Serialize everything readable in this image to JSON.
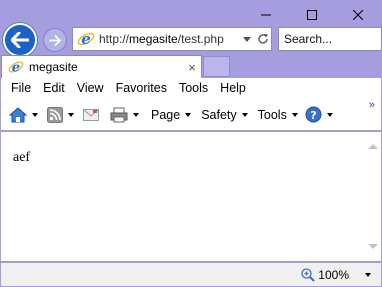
{
  "window": {
    "caption_buttons": [
      "minimize-icon",
      "maximize-icon",
      "close-icon"
    ]
  },
  "navigation": {
    "back_icon": "back-arrow-icon",
    "forward_icon": "forward-arrow-icon",
    "url_prefix": "http://",
    "url_host": "megasite",
    "url_path": "/test.php",
    "search_placeholder": "Search..."
  },
  "tab": {
    "title": "megasite",
    "close_glyph": "×"
  },
  "menu": [
    "File",
    "Edit",
    "View",
    "Favorites",
    "Tools",
    "Help"
  ],
  "commands": {
    "page": "Page",
    "safety": "Safety",
    "tools": "Tools"
  },
  "content": {
    "text": "aef"
  },
  "status": {
    "zoom": "100%"
  },
  "colors": {
    "frame": "#a69ddf",
    "back_button": "#1f62c6",
    "ie_blue": "#1e73d8",
    "ie_ring": "#f2b632"
  }
}
